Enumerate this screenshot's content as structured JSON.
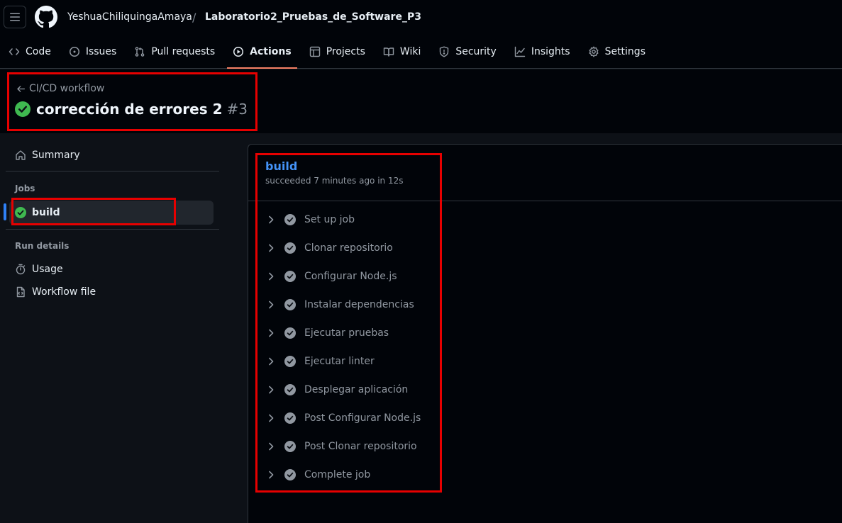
{
  "header": {
    "owner": "YeshuaChiliquingaAmaya",
    "separator": "/",
    "repo": "Laboratorio2_Pruebas_de_Software_P3"
  },
  "tabs": [
    {
      "label": "Code",
      "icon": "code-icon"
    },
    {
      "label": "Issues",
      "icon": "issue-icon"
    },
    {
      "label": "Pull requests",
      "icon": "pull-request-icon"
    },
    {
      "label": "Actions",
      "icon": "play-icon",
      "active": true
    },
    {
      "label": "Projects",
      "icon": "table-icon"
    },
    {
      "label": "Wiki",
      "icon": "book-icon"
    },
    {
      "label": "Security",
      "icon": "shield-icon"
    },
    {
      "label": "Insights",
      "icon": "graph-icon"
    },
    {
      "label": "Settings",
      "icon": "gear-icon"
    }
  ],
  "run": {
    "workflow": "CI/CD workflow",
    "title": "corrección de errores 2",
    "number": "#3"
  },
  "sidebar": {
    "summary": "Summary",
    "jobs_heading": "Jobs",
    "job": "build",
    "run_details_heading": "Run details",
    "usage": "Usage",
    "workflow_file": "Workflow file"
  },
  "job": {
    "name": "build",
    "status": "succeeded 7 minutes ago in 12s",
    "steps": [
      "Set up job",
      "Clonar repositorio",
      "Configurar Node.js",
      "Instalar dependencias",
      "Ejecutar pruebas",
      "Ejecutar linter",
      "Desplegar aplicación",
      "Post Configurar Node.js",
      "Post Clonar repositorio",
      "Complete job"
    ]
  },
  "colors": {
    "success": "#3fb950",
    "accent_link": "#4493f8",
    "active_tab_underline": "#f78166",
    "annotation": "#e60000"
  }
}
